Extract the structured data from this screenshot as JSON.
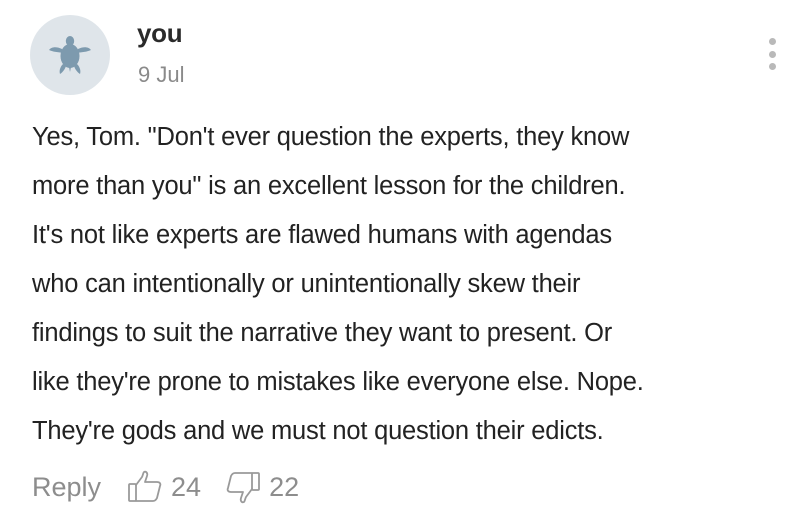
{
  "comment": {
    "author": "you",
    "date": "9 Jul",
    "avatar_icon": "turtle-icon",
    "text": "Yes, Tom. \"Don't ever question the experts, they know\nmore than you\" is an excellent lesson for the children.\nIt's not like experts are flawed humans with agendas\nwho can intentionally or unintentionally skew their\nfindings to suit the narrative they want to present. Or\nlike they're prone to mistakes like everyone else. Nope.\nThey're gods and we must not question their edicts.",
    "actions": {
      "reply_label": "Reply",
      "upvotes": "24",
      "downvotes": "22"
    }
  },
  "colors": {
    "avatar_bg": "#dfe5ea",
    "avatar_icon": "#7d9aae",
    "muted_text": "#8d8d8d",
    "body_text": "#222222"
  }
}
